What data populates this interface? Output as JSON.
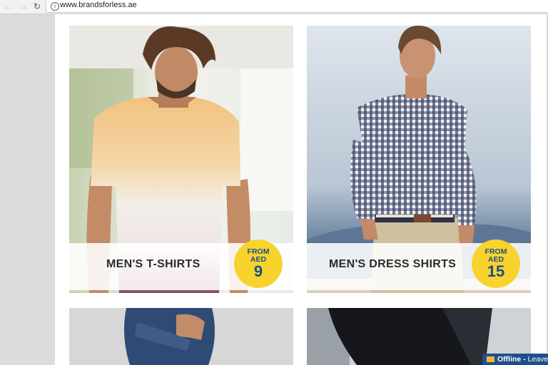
{
  "browser": {
    "url": "www.brandsforless.ae",
    "back_icon": "arrow-left-icon",
    "forward_icon": "arrow-right-icon",
    "reload_icon": "reload-icon",
    "info_icon": "info-icon"
  },
  "products": [
    {
      "label": "MEN'S T-SHIRTS",
      "price_from": "FROM",
      "currency": "AED",
      "price": "9"
    },
    {
      "label": "MEN'S DRESS SHIRTS",
      "price_from": "FROM",
      "currency": "AED",
      "price": "15"
    }
  ],
  "chat": {
    "status": "Offline",
    "action": "Leave"
  },
  "colors": {
    "badge": "#f8d32e",
    "badge_text": "#1b4f86",
    "chat_bg": "#1f4f8a"
  }
}
